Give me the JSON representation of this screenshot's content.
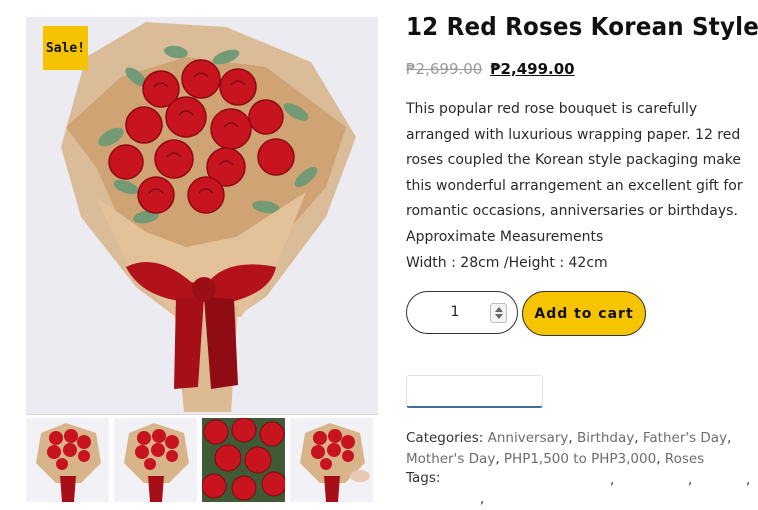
{
  "product": {
    "sale_badge": "Sale!",
    "title": "12 Red Roses Korean Style",
    "price_old": "₱2,699.00",
    "price_new": "₱2,499.00",
    "description": [
      "This popular red rose bouquet is carefully arranged with luxurious wrapping paper. 12 red roses coupled the Korean style packaging make this wonderful arrangement an excellent gift for romantic occasions, anniversaries or birthdays.",
      "Approximate Measurements",
      "Width : 28cm /Height : 42cm"
    ]
  },
  "cart": {
    "quantity": "1",
    "add_to_cart_label": "Add to cart"
  },
  "meta": {
    "categories_label": "Categories:",
    "categories": [
      "Anniversary",
      "Birthday",
      "Father's Day",
      "Mother's Day",
      "PHP1,500 to PHP3,000",
      "Roses"
    ],
    "tags_label": "Tags:"
  },
  "colors": {
    "accent": "#f7c400",
    "rose": "#c8141e",
    "wrap": "#d9b48a"
  }
}
